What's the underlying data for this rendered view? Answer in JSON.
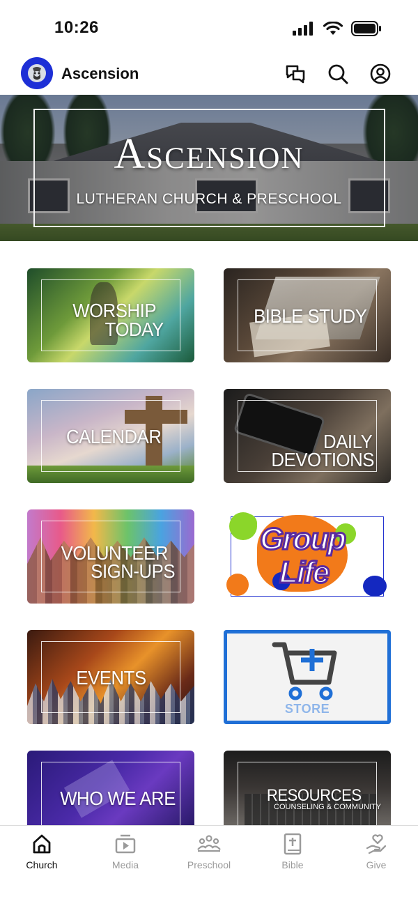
{
  "status_bar": {
    "time": "10:26"
  },
  "header": {
    "title": "Ascension"
  },
  "hero": {
    "title": "Ascension",
    "subtitle": "LUTHERAN CHURCH & PRESCHOOL"
  },
  "tiles": [
    {
      "line1": "WORSHIP",
      "line2": "TODAY"
    },
    {
      "line1": "BIBLE STUDY"
    },
    {
      "line1": "CALENDAR"
    },
    {
      "line1": "DAILY",
      "line2": "DEVOTIONS"
    },
    {
      "line1": "VOLUNTEER",
      "line2": "SIGN-UPS"
    },
    {
      "line1": "Group",
      "line2": "Life"
    },
    {
      "line1": "EVENTS"
    },
    {
      "line1": "STORE"
    },
    {
      "line1": "WHO WE ARE"
    },
    {
      "line1": "RESOURCES",
      "line2": "COUNSELING & COMMUNITY"
    }
  ],
  "tabs": [
    {
      "label": "Church",
      "active": true
    },
    {
      "label": "Media"
    },
    {
      "label": "Preschool"
    },
    {
      "label": "Bible"
    },
    {
      "label": "Give"
    }
  ],
  "colors": {
    "accent_blue": "#1f6fd6",
    "logo_bg": "#1d2fd6",
    "inactive_tab": "#9a9a9a"
  }
}
